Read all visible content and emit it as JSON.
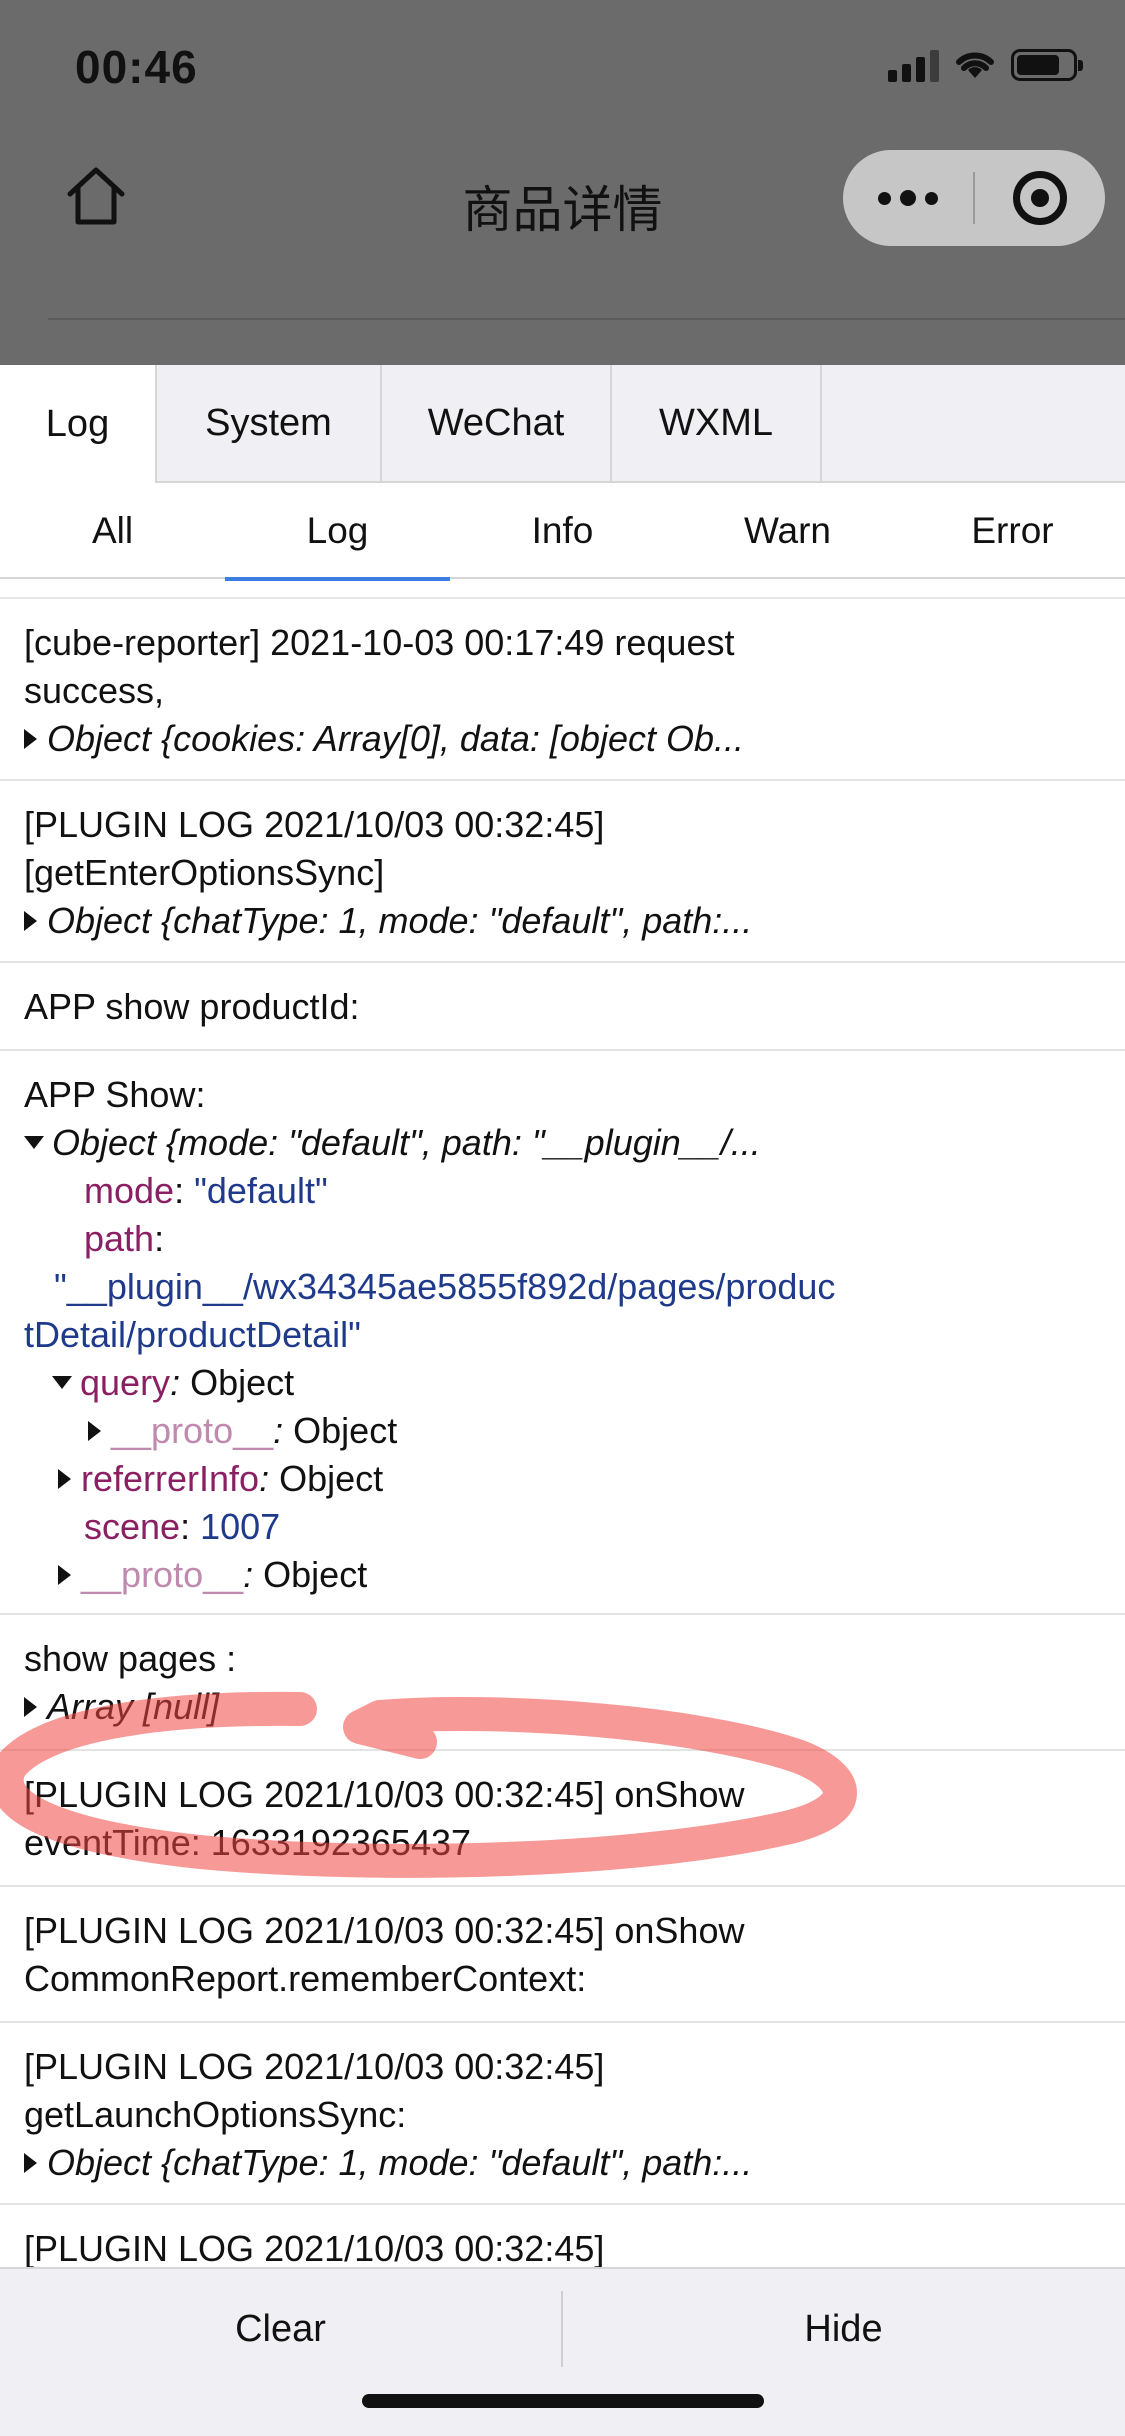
{
  "status_bar": {
    "time": "00:46"
  },
  "nav": {
    "title": "商品详情"
  },
  "console": {
    "tabs": [
      "Log",
      "System",
      "WeChat",
      "WXML"
    ],
    "active_tab": "Log",
    "filters": [
      "All",
      "Log",
      "Info",
      "Warn",
      "Error"
    ],
    "active_filter": "Log"
  },
  "logs": {
    "e1": {
      "l1": "[cube-reporter] 2021-10-03 00:17:49 request",
      "l2": "success,",
      "l3": "Object {cookies: Array[0], data: [object Ob..."
    },
    "e2": {
      "l1": "[PLUGIN LOG 2021/10/03 00:32:45]",
      "l2": "[getEnterOptionsSync]",
      "l3": "Object {chatType: 1, mode: \"default\", path:..."
    },
    "e3": {
      "l1": "APP show productId:"
    },
    "e4": {
      "l1": "APP Show:",
      "l2": "Object {mode: \"default\", path: \"__plugin__/...",
      "mode_key": "mode",
      "mode_val": "\"default\"",
      "path_key": "path",
      "path_val_1": "\"__plugin__/wx34345ae5855f892d/pages/produc",
      "path_val_2": "tDetail/productDetail\"",
      "query_key": "query",
      "query_val": "Object",
      "proto1_key": "__proto__",
      "proto1_val": "Object",
      "referrer_key": "referrerInfo",
      "referrer_val": "Object",
      "scene_key": "scene",
      "scene_val": "1007",
      "proto2_key": "__proto__",
      "proto2_val": "Object"
    },
    "e5": {
      "l1": "show pages :",
      "l2": "Array [null]"
    },
    "e6": {
      "l1": "[PLUGIN LOG 2021/10/03 00:32:45] onShow",
      "l2": "eventTime: 1633192365437"
    },
    "e7": {
      "l1": "[PLUGIN LOG 2021/10/03 00:32:45] onShow",
      "l2": "CommonReport.rememberContext:"
    },
    "e8": {
      "l1": "[PLUGIN LOG 2021/10/03 00:32:45]",
      "l2": "getLaunchOptionsSync:",
      "l3": "Object {chatType: 1, mode: \"default\", path:..."
    },
    "e9": {
      "l1": "[PLUGIN LOG 2021/10/03 00:32:45]"
    }
  },
  "bottom": {
    "clear": "Clear",
    "hide": "Hide"
  }
}
